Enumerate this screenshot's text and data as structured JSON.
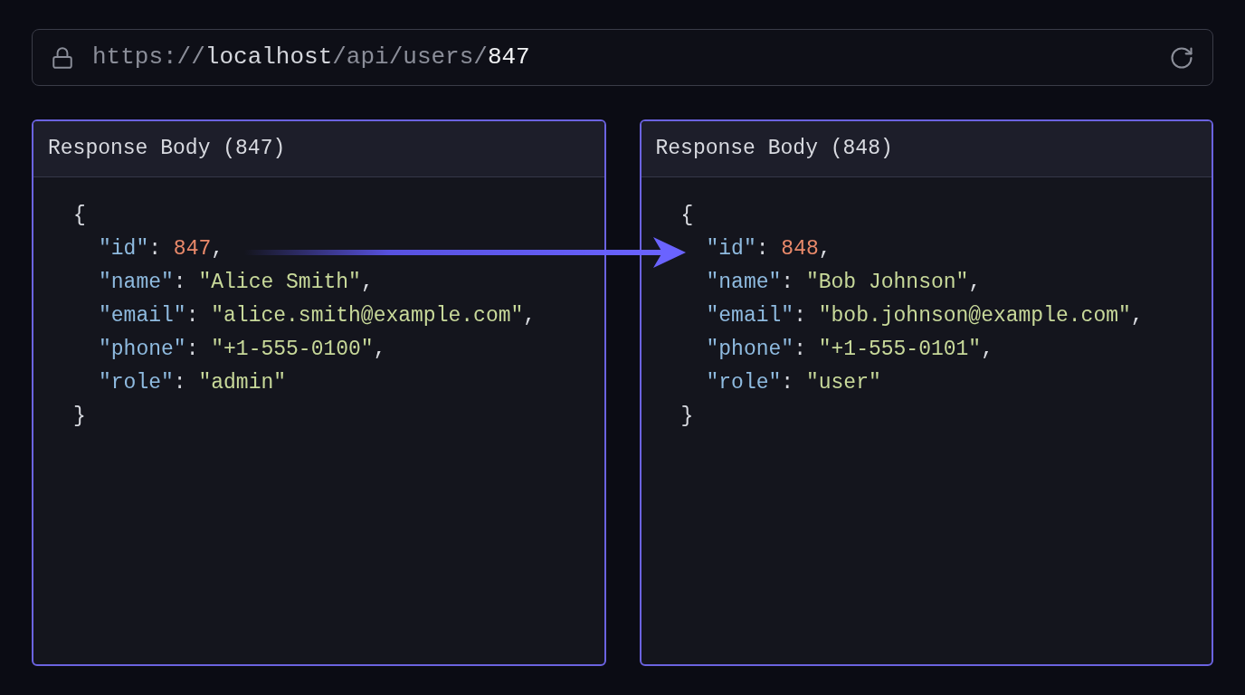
{
  "address_bar": {
    "url_parts": [
      {
        "text": "https://",
        "kind": "dim"
      },
      {
        "text": "localhost",
        "kind": "host"
      },
      {
        "text": "/api/users/",
        "kind": "dim"
      },
      {
        "text": "847",
        "kind": "id"
      }
    ]
  },
  "panels": [
    {
      "title": "Response Body (847)",
      "open": "{",
      "close": "}",
      "lines": [
        {
          "key": "\"id\"",
          "colon": ": ",
          "value": "847",
          "kind": "number",
          "comma": ","
        },
        {
          "key": "\"name\"",
          "colon": ": ",
          "value": "\"Alice Smith\"",
          "kind": "string",
          "comma": ","
        },
        {
          "key": "\"email\"",
          "colon": ": ",
          "value": "\"alice.smith@example.com\"",
          "kind": "string",
          "comma": ","
        },
        {
          "key": "\"phone\"",
          "colon": ": ",
          "value": "\"+1-555-0100\"",
          "kind": "string",
          "comma": ","
        },
        {
          "key": "\"role\"",
          "colon": ": ",
          "value": "\"admin\"",
          "kind": "string"
        }
      ]
    },
    {
      "title": "Response Body (848)",
      "open": "{",
      "close": "}",
      "lines": [
        {
          "key": "\"id\"",
          "colon": ": ",
          "value": "848",
          "kind": "number",
          "comma": ","
        },
        {
          "key": "\"name\"",
          "colon": ": ",
          "value": "\"Bob Johnson\"",
          "kind": "string",
          "comma": ","
        },
        {
          "key": "\"email\"",
          "colon": ": ",
          "value": "\"bob.johnson@example.com\"",
          "kind": "string",
          "comma": ","
        },
        {
          "key": "\"phone\"",
          "colon": ": ",
          "value": "\"+1-555-0101\"",
          "kind": "string",
          "comma": ","
        },
        {
          "key": "\"role\"",
          "colon": ": ",
          "value": "\"user\"",
          "kind": "string"
        }
      ]
    }
  ]
}
